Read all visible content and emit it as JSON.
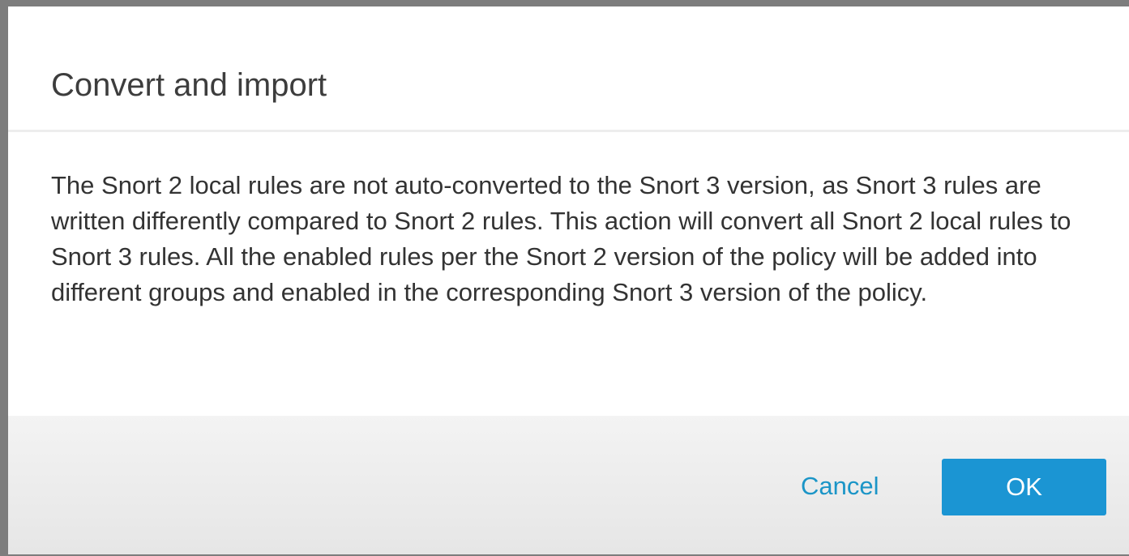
{
  "dialog": {
    "title": "Convert and import",
    "message": "The Snort 2 local rules are not auto-converted to the Snort 3 version, as Snort 3 rules are written differently compared to Snort 2 rules. This action will convert all Snort 2 local rules to Snort 3 rules. All the enabled rules per the Snort 2 version of the policy will be added into different groups and enabled in the corresponding Snort 3 version of the policy.",
    "cancel_label": "Cancel",
    "ok_label": "OK"
  },
  "colors": {
    "accent": "#1b95d3",
    "link": "#1b95c7",
    "overlay": "#7d7d7d"
  }
}
